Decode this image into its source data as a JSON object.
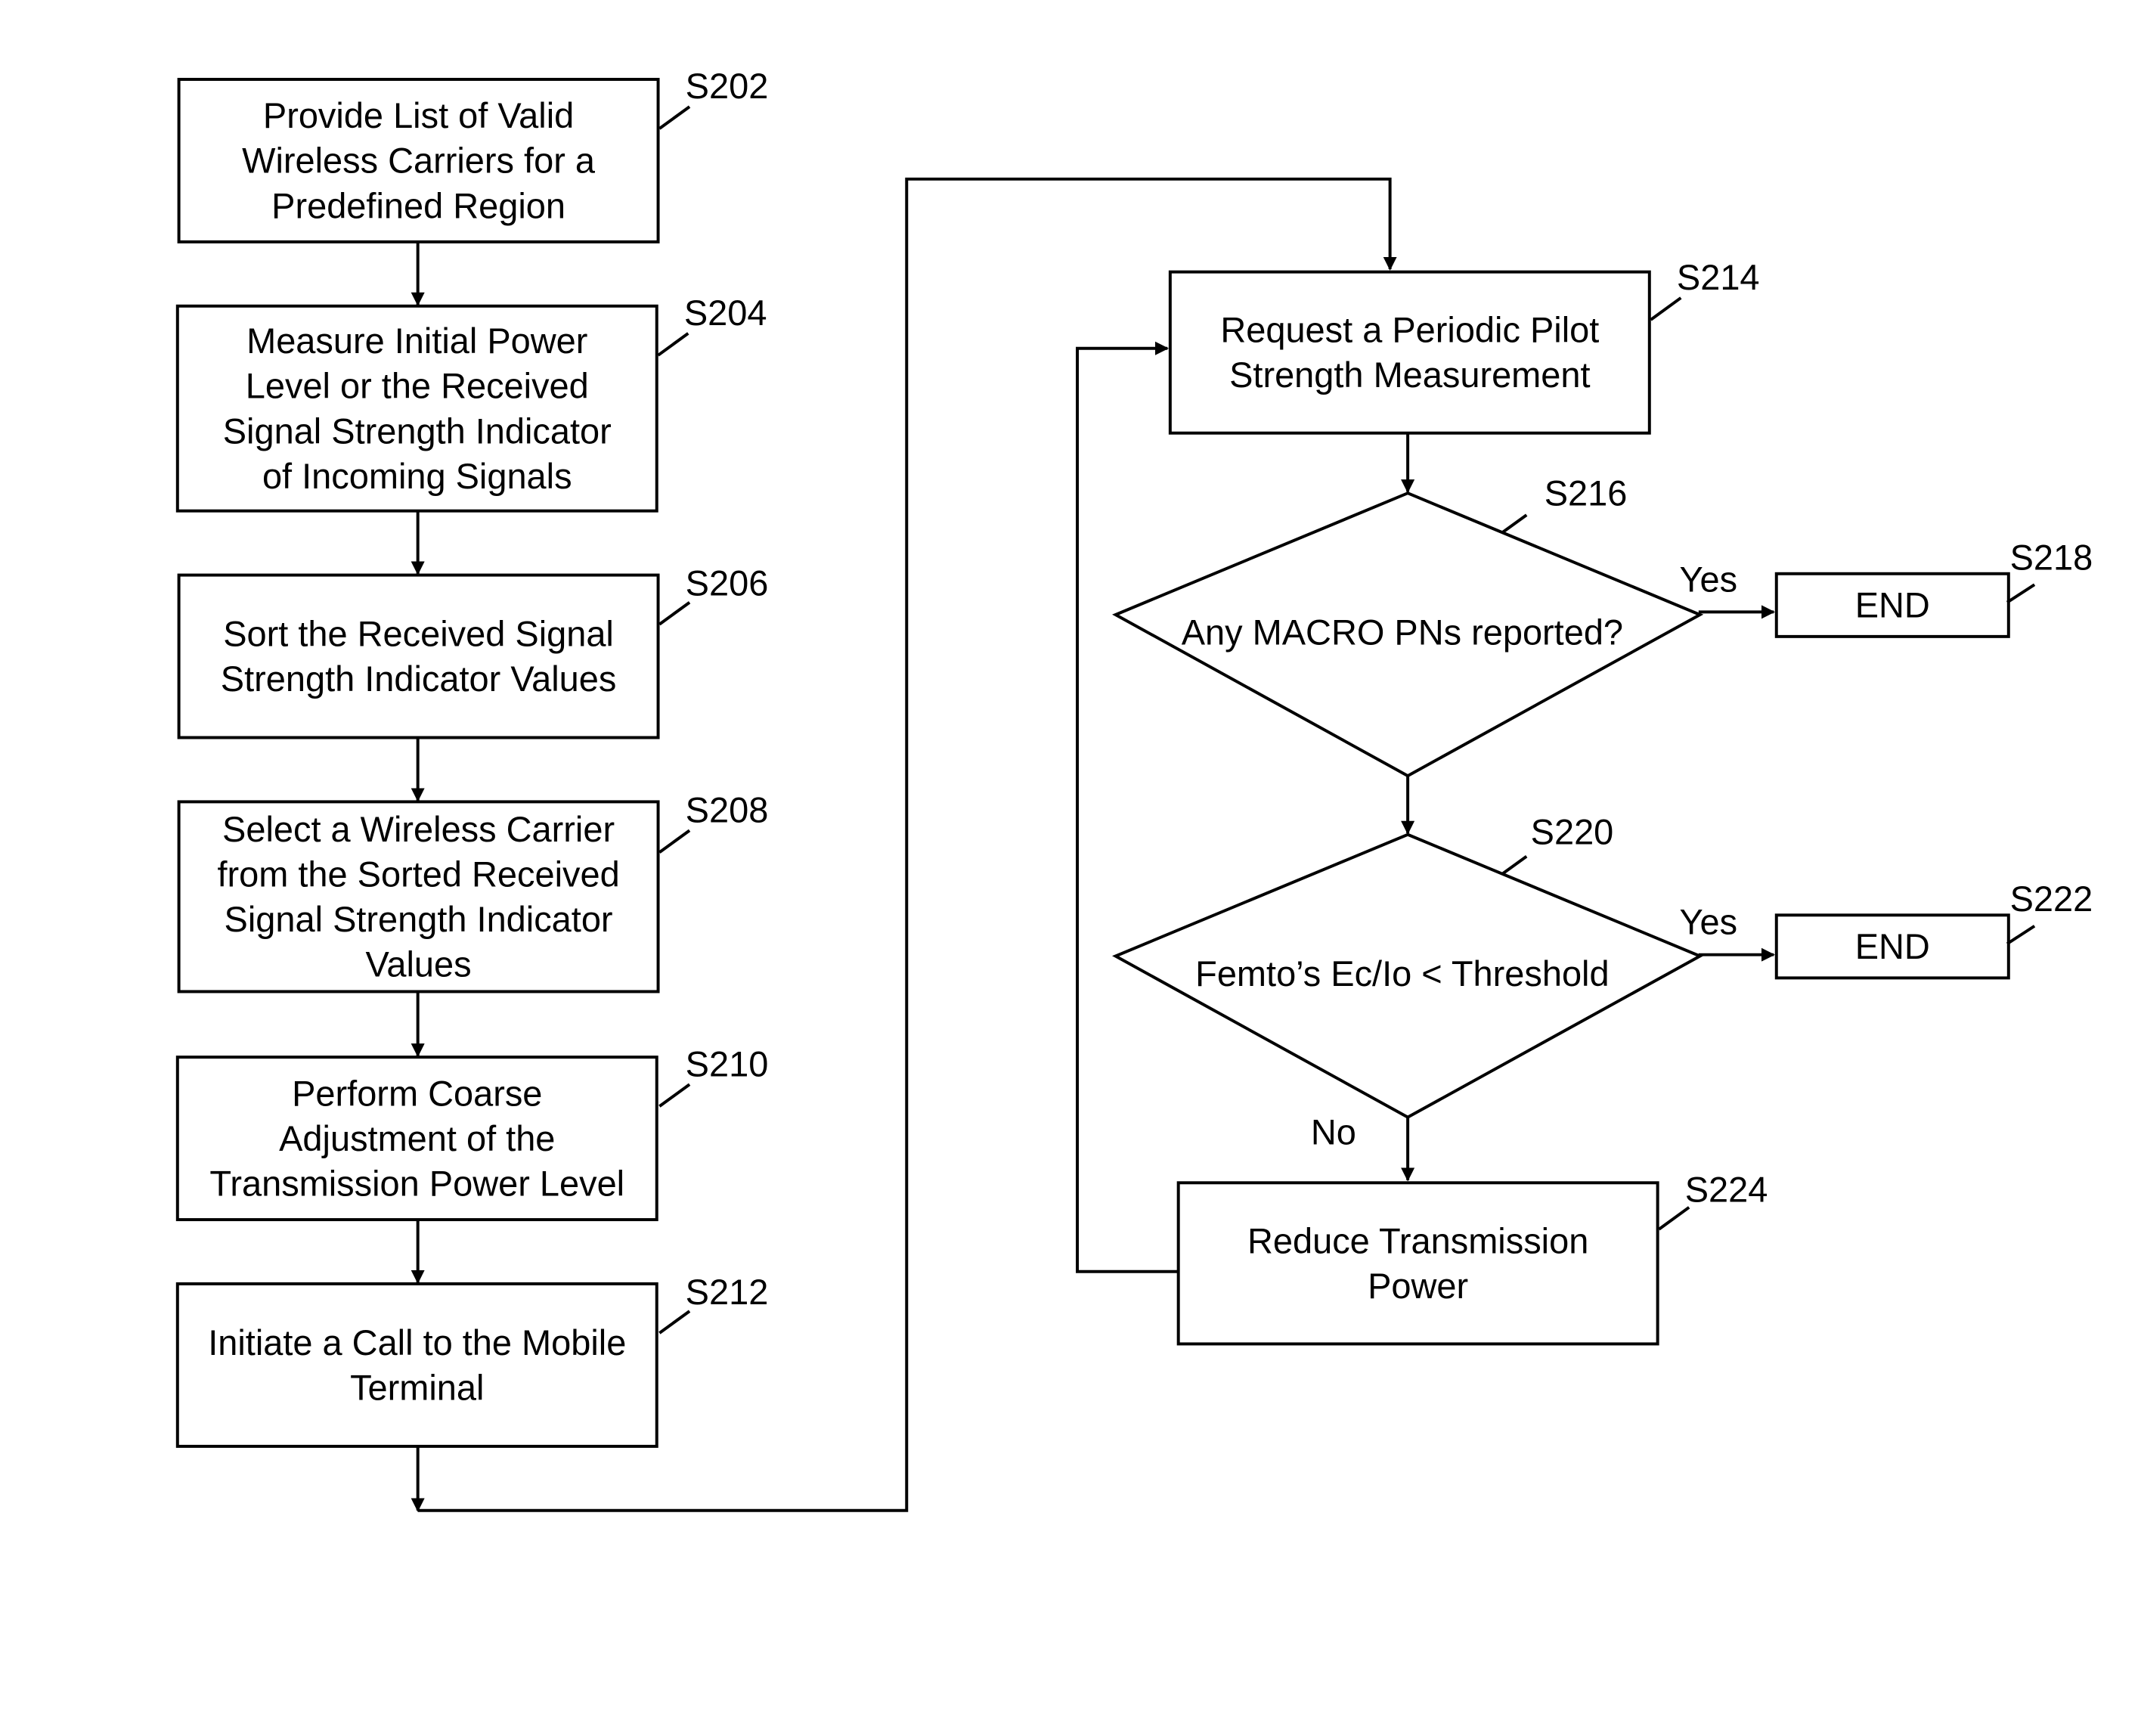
{
  "diagram": {
    "type": "flowchart",
    "steps": [
      {
        "id": "S202",
        "label": "S202",
        "lines": [
          "Provide List of Valid",
          "Wireless Carriers for a",
          "Predefined Region"
        ]
      },
      {
        "id": "S204",
        "label": "S204",
        "lines": [
          "Measure Initial Power",
          "Level or the Received",
          "Signal Strength Indicator",
          "of Incoming Signals"
        ]
      },
      {
        "id": "S206",
        "label": "S206",
        "lines": [
          "Sort the Received Signal",
          "Strength Indicator Values"
        ]
      },
      {
        "id": "S208",
        "label": "S208",
        "lines": [
          "Select a Wireless Carrier",
          "from the Sorted Received",
          "Signal Strength Indicator",
          "Values"
        ]
      },
      {
        "id": "S210",
        "label": "S210",
        "lines": [
          "Perform Coarse",
          "Adjustment of the",
          "Transmission Power Level"
        ]
      },
      {
        "id": "S212",
        "label": "S212",
        "lines": [
          "Initiate a Call to the Mobile",
          "Terminal"
        ]
      },
      {
        "id": "S214",
        "label": "S214",
        "lines": [
          "Request a Periodic Pilot",
          "Strength Measurement"
        ]
      },
      {
        "id": "S216",
        "label": "S216",
        "lines": [
          "Any MACRO PNs reported?"
        ]
      },
      {
        "id": "S218",
        "label": "S218",
        "lines": [
          "END"
        ]
      },
      {
        "id": "S220",
        "label": "S220",
        "lines": [
          "Femto’s Ec/Io < Threshold"
        ]
      },
      {
        "id": "S222",
        "label": "S222",
        "lines": [
          "END"
        ]
      },
      {
        "id": "S224",
        "label": "S224",
        "lines": [
          "Reduce Transmission",
          "Power"
        ]
      }
    ],
    "edge_labels": {
      "yes1": "Yes",
      "yes2": "Yes",
      "no": "No"
    }
  }
}
